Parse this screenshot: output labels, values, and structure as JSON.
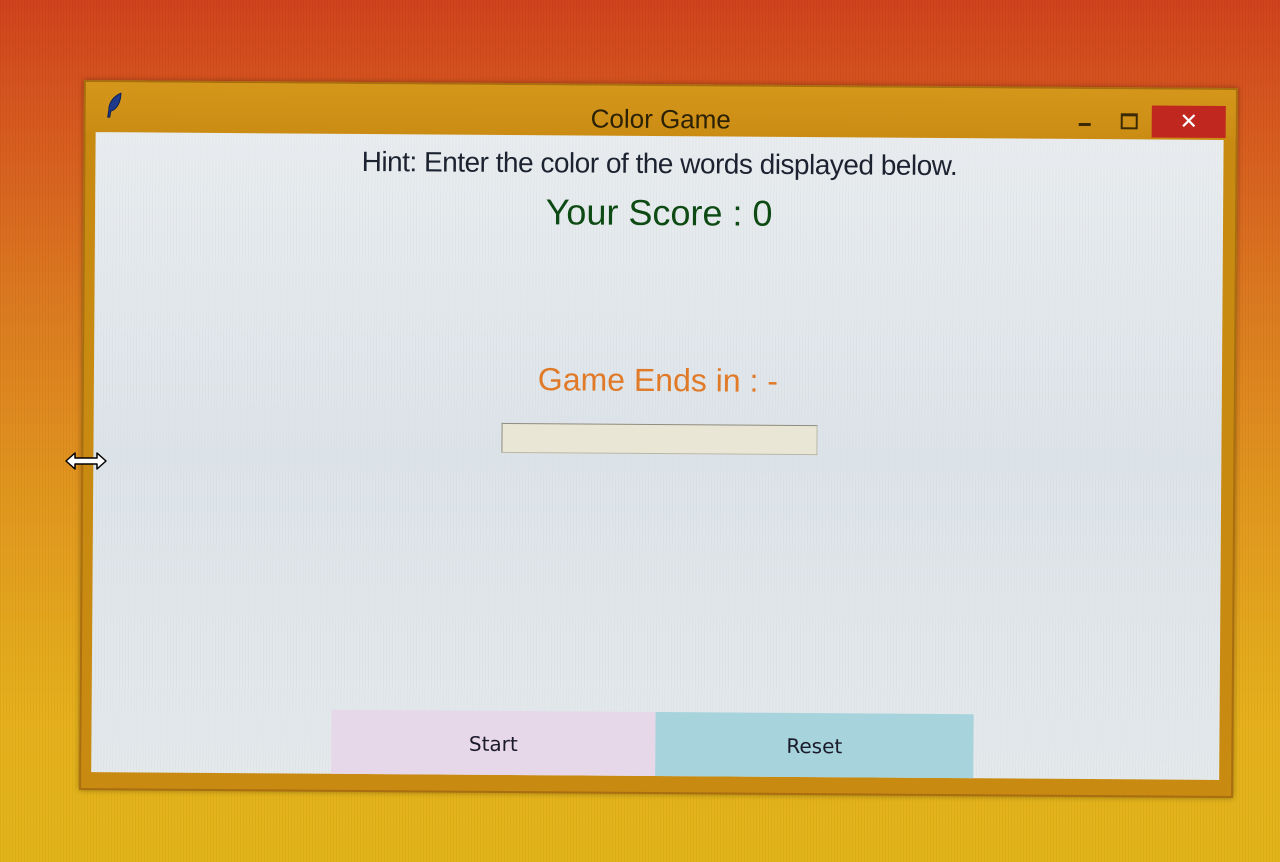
{
  "window": {
    "title": "Color Game",
    "controls": {
      "minimize": "minimize",
      "maximize": "maximize",
      "close_label": "✕"
    }
  },
  "game": {
    "hint": "Hint: Enter the color of the words displayed below.",
    "score": "Your Score : 0",
    "timer": "Game Ends in : -",
    "entry_value": ""
  },
  "buttons": {
    "start_label": "Start",
    "reset_label": "Reset"
  },
  "colors": {
    "score_text": "#0e4a14",
    "timer_text": "#e07a28",
    "start_button_bg": "#e6d7e9",
    "reset_button_bg": "#a6d3dc",
    "close_button_bg": "#c0281f"
  },
  "icons": {
    "app_icon": "feather-icon",
    "cursor": "horizontal-resize-cursor-icon"
  }
}
